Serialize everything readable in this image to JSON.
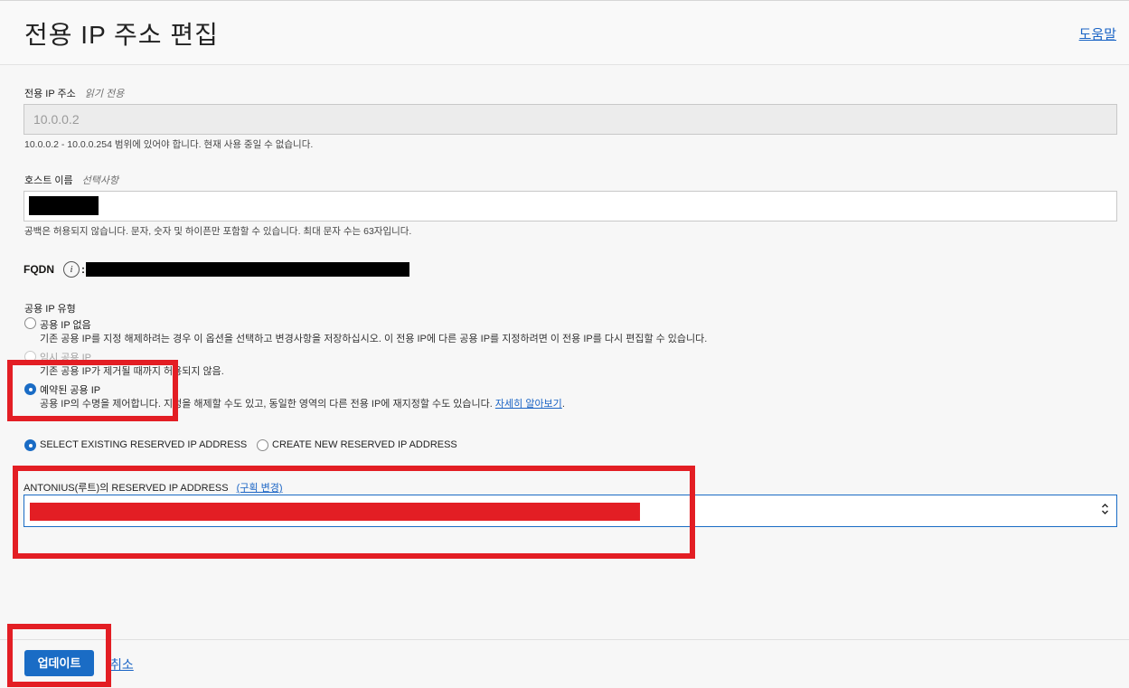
{
  "header": {
    "title": "전용 IP 주소 편집",
    "help_link": "도움말"
  },
  "private_ip": {
    "label": "전용 IP 주소",
    "qualifier": "읽기 전용",
    "value": "10.0.0.2",
    "hint": "10.0.0.2 - 10.0.0.254 범위에 있어야 합니다. 현재 사용 중일 수 없습니다."
  },
  "hostname": {
    "label": "호스트 이름",
    "qualifier": "선택사항",
    "hint": "공백은 허용되지 않습니다. 문자, 숫자 및 하이픈만 포함할 수 있습니다. 최대 문자 수는 63자입니다."
  },
  "fqdn": {
    "label": "FQDN",
    "info_icon": "info-icon",
    "colon": ":"
  },
  "public_ip_type": {
    "label": "공용 IP 유형",
    "options": [
      {
        "label": "공용 IP 없음",
        "description": "기존 공용 IP를 지정 해제하려는 경우 이 옵션을 선택하고 변경사항을 저장하십시오. 이 전용 IP에 다른 공용 IP를 지정하려면 이 전용 IP를 다시 편집할 수 있습니다.",
        "selected": false,
        "disabled": false
      },
      {
        "label": "임시 공용 IP",
        "description": "기존 공용 IP가 제거될 때까지 허용되지 않음.",
        "selected": false,
        "disabled": true
      },
      {
        "label": "예약된 공용 IP",
        "description": "공용 IP의 수명을 제어합니다. 지정을 해제할 수도 있고, 동일한 영역의 다른 전용 IP에 재지정할 수도 있습니다.",
        "link": "자세히 알아보기",
        "trailing": ".",
        "selected": true,
        "disabled": false
      }
    ]
  },
  "reserved_mode": {
    "options": [
      {
        "label": "SELECT EXISTING RESERVED IP ADDRESS",
        "selected": true
      },
      {
        "label": "CREATE NEW RESERVED IP ADDRESS",
        "selected": false
      }
    ]
  },
  "reserved_select": {
    "label": "ANTONIUS(루트)의 RESERVED IP ADDRESS",
    "change_link": "(구획 변경)",
    "chevron_icon": "updown-chevron-icon"
  },
  "footer": {
    "update_label": "업데이트",
    "cancel_label": "취소"
  },
  "colors": {
    "accent": "#1a6cc5",
    "highlight": "#e31e24",
    "link": "#1a64c5"
  }
}
